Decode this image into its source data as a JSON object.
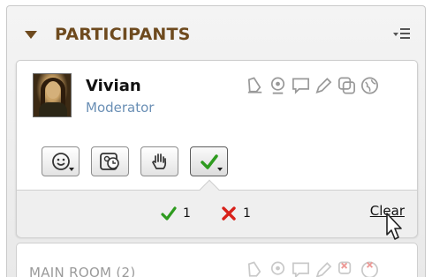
{
  "panel": {
    "title": "PARTICIPANTS"
  },
  "participant": {
    "name": "Vivian",
    "role": "Moderator",
    "avatar": "mona-lisa-avatar",
    "status_icons": [
      "pen-hand-icon",
      "webcam-icon",
      "chat-bubble-icon",
      "pencil-icon",
      "copy-screens-icon",
      "globe-icon"
    ]
  },
  "actions": [
    "emoticon-icon",
    "away-clock-icon",
    "raise-hand-icon",
    "agree-check-icon"
  ],
  "summary": {
    "agree_count": "1",
    "disagree_count": "1",
    "clear_label": "Clear"
  },
  "room": {
    "label": "MAIN ROOM (2)"
  },
  "colors": {
    "header_text": "#6e4a1e",
    "role_text": "#6a8fb5",
    "agree_green": "#2e9b1f",
    "disagree_red": "#d8211a"
  }
}
